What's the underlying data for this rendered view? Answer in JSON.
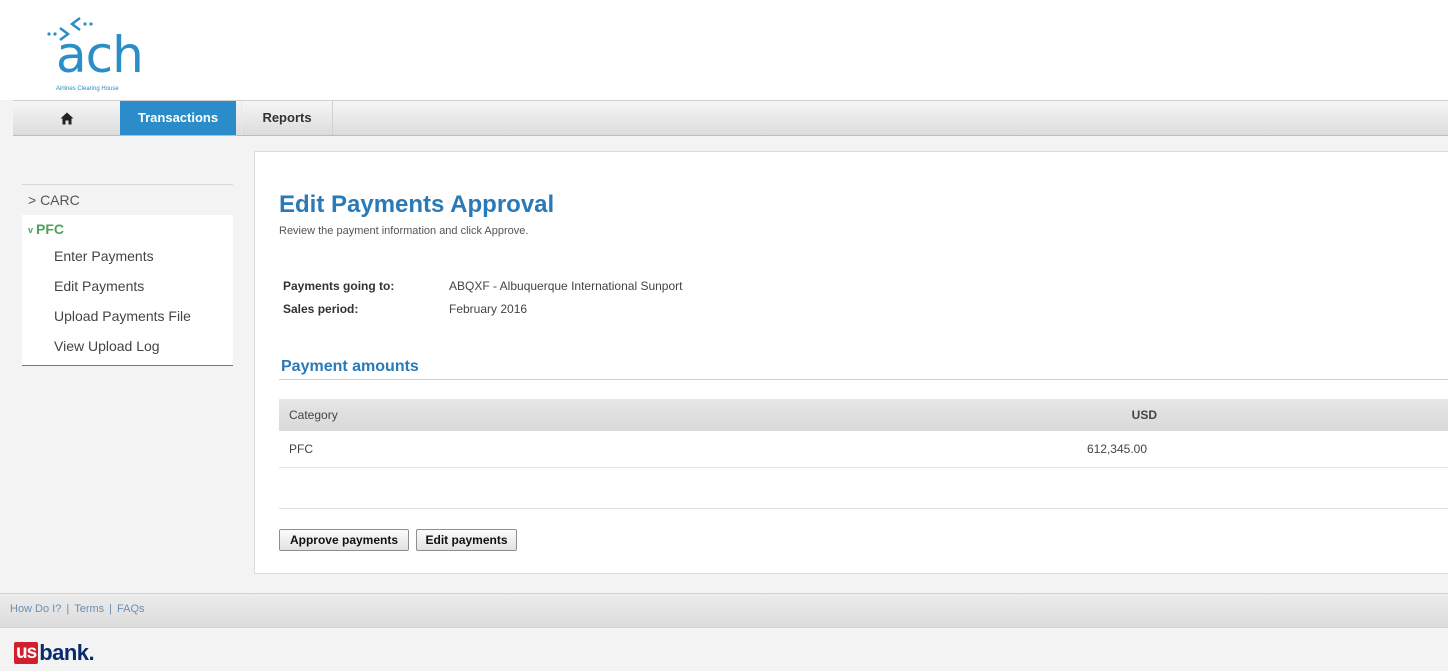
{
  "logo": {
    "word": "ach",
    "subtitle": "Airlines Clearing House"
  },
  "nav": {
    "home_icon": "home-icon",
    "tabs": [
      {
        "label": "Transactions",
        "active": true
      },
      {
        "label": "Reports",
        "active": false
      }
    ]
  },
  "sidebar": {
    "carc": "> CARC",
    "pfc_chevron": "v",
    "pfc": "PFC",
    "items": [
      {
        "label": "Enter Payments"
      },
      {
        "label": "Edit Payments"
      },
      {
        "label": "Upload Payments File"
      },
      {
        "label": "View Upload Log"
      }
    ]
  },
  "main": {
    "title": "Edit Payments Approval",
    "subtitle": "Review the payment information and click Approve.",
    "info": [
      {
        "label": "Payments going to:",
        "value": "ABQXF  - Albuquerque International Sunport"
      },
      {
        "label": "Sales period:",
        "value": "February  2016"
      }
    ],
    "section_title": "Payment amounts",
    "table": {
      "headers": [
        "Category",
        "USD"
      ],
      "rows": [
        [
          "PFC",
          "612,345.00"
        ]
      ]
    },
    "buttons": {
      "approve": "Approve payments",
      "edit": "Edit payments"
    }
  },
  "footer": {
    "links": [
      "How Do I?",
      "Terms",
      "FAQs"
    ],
    "separator": "|",
    "brand_us": "us",
    "brand_bank": "bank."
  },
  "colors": {
    "accent": "#2a8dc9",
    "title": "#2a7ab8",
    "pfc_green": "#4aa25b",
    "usbank_red": "#d11f2e",
    "usbank_navy": "#0a2b6b"
  }
}
